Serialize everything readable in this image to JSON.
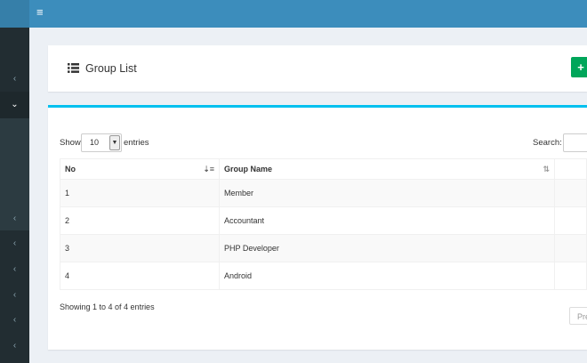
{
  "topbar": {
    "menu_icon": "hamburger-icon"
  },
  "sidebar": {
    "items": [
      {
        "icon": "chevron-left-icon"
      },
      {
        "icon": "chevron-down-icon",
        "open": true
      },
      {
        "icon": "chevron-left-icon"
      },
      {
        "icon": "chevron-left-icon"
      },
      {
        "icon": "chevron-left-icon"
      },
      {
        "icon": "chevron-left-icon"
      },
      {
        "icon": "chevron-left-icon"
      },
      {
        "icon": "chevron-left-icon"
      }
    ]
  },
  "header": {
    "title": "Group List",
    "list_icon": "list-icon",
    "add_button_label": "+"
  },
  "table_controls": {
    "show_label": "Show",
    "page_length": "10",
    "entries_label": "entries",
    "search_label": "Search:"
  },
  "table": {
    "columns": [
      "No",
      "Group Name"
    ],
    "rows": [
      {
        "no": "1",
        "name": "Member"
      },
      {
        "no": "2",
        "name": "Accountant"
      },
      {
        "no": "3",
        "name": "PHP Developer"
      },
      {
        "no": "4",
        "name": "Android"
      }
    ]
  },
  "footer": {
    "info": "Showing 1 to 4 of 4 entries",
    "prev_label": "Previous"
  },
  "colors": {
    "topbar": "#3c8dbc",
    "sidebar": "#222d32",
    "accent_border": "#00c0ef",
    "add_button": "#00a65a"
  }
}
